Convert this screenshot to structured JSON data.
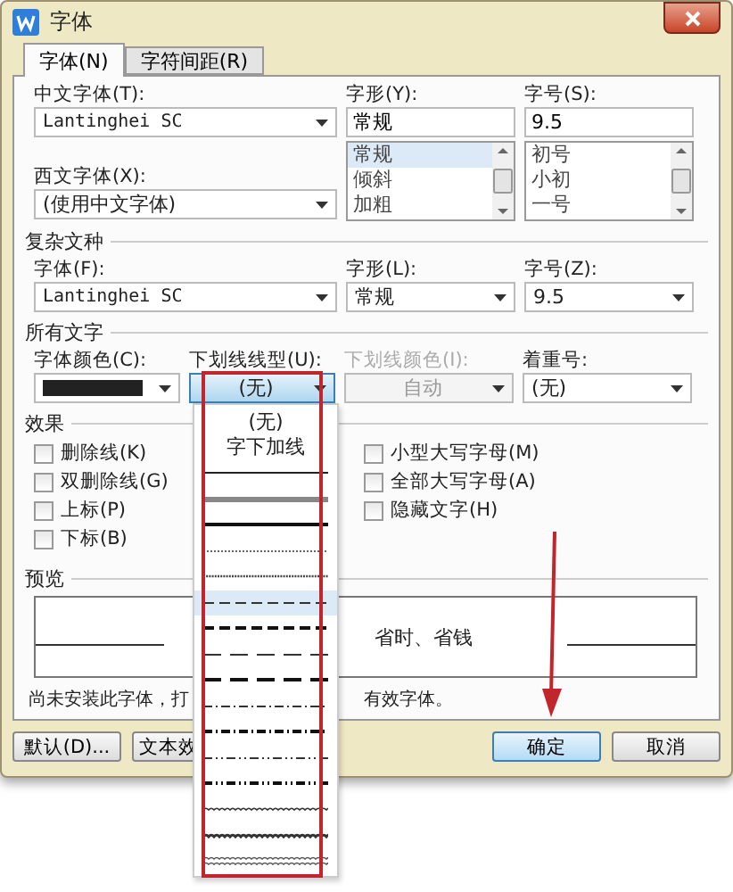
{
  "window": {
    "title": "字体"
  },
  "tabs": [
    {
      "label": "字体(N)",
      "selected": true
    },
    {
      "label": "字符间距(R)",
      "selected": false
    }
  ],
  "font": {
    "chinese_label": "中文字体(T):",
    "chinese_value": "Lantinghei SC",
    "western_label": "西文字体(X):",
    "western_value": "(使用中文字体)",
    "style_label": "字形(Y):",
    "style_value": "常规",
    "style_items": [
      {
        "label": "常规",
        "selected": true
      },
      {
        "label": "倾斜",
        "selected": false
      },
      {
        "label": "加粗",
        "selected": false
      }
    ],
    "size_label": "字号(S):",
    "size_value": "9.5",
    "size_items": [
      {
        "label": "初号",
        "selected": false
      },
      {
        "label": "小初",
        "selected": false
      },
      {
        "label": "一号",
        "selected": false
      }
    ]
  },
  "complex": {
    "heading": "复杂文种",
    "font_label": "字体(F):",
    "font_value": "Lantinghei SC",
    "style_label": "字形(L):",
    "style_value": "常规",
    "size_label": "字号(Z):",
    "size_value": "9.5"
  },
  "all_text": {
    "heading": "所有文字",
    "font_color": {
      "label": "字体颜色(C):",
      "color": "#222222"
    },
    "underline_style": {
      "label": "下划线线型(U):",
      "value": "(无)",
      "open": true
    },
    "underline_color": {
      "label": "下划线颜色(I):",
      "value": "自动",
      "disabled": true
    },
    "emphasis": {
      "label": "着重号:",
      "value": "(无)"
    }
  },
  "effects": {
    "heading": "效果",
    "left": [
      {
        "label": "删除线(K)",
        "checked": false
      },
      {
        "label": "双删除线(G)",
        "checked": false
      },
      {
        "label": "上标(P)",
        "checked": false
      },
      {
        "label": "下标(B)",
        "checked": false
      }
    ],
    "right": [
      {
        "label": "小型大写字母(M)",
        "checked": false
      },
      {
        "label": "全部大写字母(A)",
        "checked": false
      },
      {
        "label": "隐藏文字(H)",
        "checked": false
      }
    ]
  },
  "preview": {
    "heading": "预览",
    "sample": "省时、省钱",
    "note_start": "尚未安装此字体，打",
    "note_end": "有效字体。"
  },
  "buttons": [
    {
      "label": "默认(D)...",
      "kind": "normal"
    },
    {
      "label": "文本效",
      "kind": "normal"
    },
    {
      "label": "确定",
      "kind": "default"
    },
    {
      "label": "取消",
      "kind": "normal"
    }
  ],
  "underline_options": [
    {
      "kind": "text",
      "label": "(无)",
      "selected": false
    },
    {
      "kind": "text",
      "label": "字下加线",
      "selected": false
    },
    {
      "kind": "solid",
      "selected": false
    },
    {
      "kind": "thick-gray",
      "selected": false
    },
    {
      "kind": "thick",
      "selected": false
    },
    {
      "kind": "dotted",
      "selected": false
    },
    {
      "kind": "dotted-dense",
      "selected": false
    },
    {
      "kind": "dash",
      "selected": true
    },
    {
      "kind": "dash-thick",
      "selected": false
    },
    {
      "kind": "long-dash",
      "selected": false
    },
    {
      "kind": "long-dash-thick",
      "selected": false
    },
    {
      "kind": "dash-dot",
      "selected": false
    },
    {
      "kind": "dash-dot-thick",
      "selected": false
    },
    {
      "kind": "dash-dot-dot",
      "selected": false
    },
    {
      "kind": "dash-dot-dot-thick",
      "selected": false
    },
    {
      "kind": "wave",
      "selected": false
    },
    {
      "kind": "wave-thick",
      "selected": false
    },
    {
      "kind": "double-wave",
      "selected": false
    }
  ]
}
